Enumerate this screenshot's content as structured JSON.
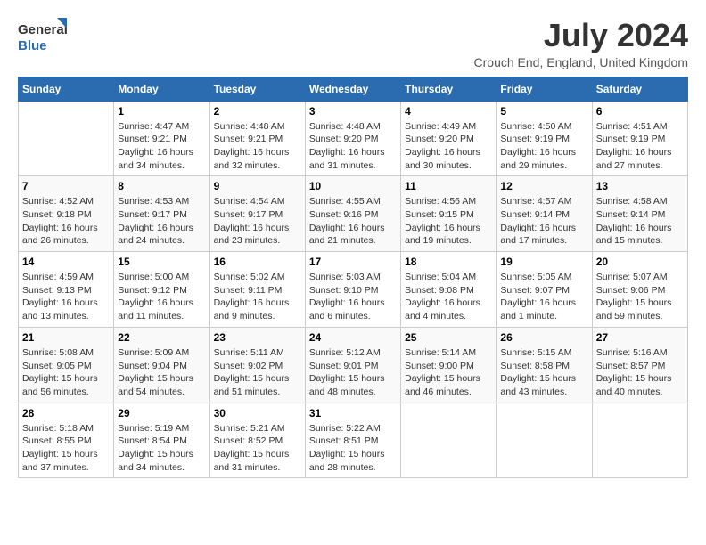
{
  "logo": {
    "text_general": "General",
    "text_blue": "Blue"
  },
  "header": {
    "month_title": "July 2024",
    "location": "Crouch End, England, United Kingdom"
  },
  "days_of_week": [
    "Sunday",
    "Monday",
    "Tuesday",
    "Wednesday",
    "Thursday",
    "Friday",
    "Saturday"
  ],
  "weeks": [
    [
      {
        "day": "",
        "sunrise": "",
        "sunset": "",
        "daylight": ""
      },
      {
        "day": "1",
        "sunrise": "Sunrise: 4:47 AM",
        "sunset": "Sunset: 9:21 PM",
        "daylight": "Daylight: 16 hours and 34 minutes."
      },
      {
        "day": "2",
        "sunrise": "Sunrise: 4:48 AM",
        "sunset": "Sunset: 9:21 PM",
        "daylight": "Daylight: 16 hours and 32 minutes."
      },
      {
        "day": "3",
        "sunrise": "Sunrise: 4:48 AM",
        "sunset": "Sunset: 9:20 PM",
        "daylight": "Daylight: 16 hours and 31 minutes."
      },
      {
        "day": "4",
        "sunrise": "Sunrise: 4:49 AM",
        "sunset": "Sunset: 9:20 PM",
        "daylight": "Daylight: 16 hours and 30 minutes."
      },
      {
        "day": "5",
        "sunrise": "Sunrise: 4:50 AM",
        "sunset": "Sunset: 9:19 PM",
        "daylight": "Daylight: 16 hours and 29 minutes."
      },
      {
        "day": "6",
        "sunrise": "Sunrise: 4:51 AM",
        "sunset": "Sunset: 9:19 PM",
        "daylight": "Daylight: 16 hours and 27 minutes."
      }
    ],
    [
      {
        "day": "7",
        "sunrise": "Sunrise: 4:52 AM",
        "sunset": "Sunset: 9:18 PM",
        "daylight": "Daylight: 16 hours and 26 minutes."
      },
      {
        "day": "8",
        "sunrise": "Sunrise: 4:53 AM",
        "sunset": "Sunset: 9:17 PM",
        "daylight": "Daylight: 16 hours and 24 minutes."
      },
      {
        "day": "9",
        "sunrise": "Sunrise: 4:54 AM",
        "sunset": "Sunset: 9:17 PM",
        "daylight": "Daylight: 16 hours and 23 minutes."
      },
      {
        "day": "10",
        "sunrise": "Sunrise: 4:55 AM",
        "sunset": "Sunset: 9:16 PM",
        "daylight": "Daylight: 16 hours and 21 minutes."
      },
      {
        "day": "11",
        "sunrise": "Sunrise: 4:56 AM",
        "sunset": "Sunset: 9:15 PM",
        "daylight": "Daylight: 16 hours and 19 minutes."
      },
      {
        "day": "12",
        "sunrise": "Sunrise: 4:57 AM",
        "sunset": "Sunset: 9:14 PM",
        "daylight": "Daylight: 16 hours and 17 minutes."
      },
      {
        "day": "13",
        "sunrise": "Sunrise: 4:58 AM",
        "sunset": "Sunset: 9:14 PM",
        "daylight": "Daylight: 16 hours and 15 minutes."
      }
    ],
    [
      {
        "day": "14",
        "sunrise": "Sunrise: 4:59 AM",
        "sunset": "Sunset: 9:13 PM",
        "daylight": "Daylight: 16 hours and 13 minutes."
      },
      {
        "day": "15",
        "sunrise": "Sunrise: 5:00 AM",
        "sunset": "Sunset: 9:12 PM",
        "daylight": "Daylight: 16 hours and 11 minutes."
      },
      {
        "day": "16",
        "sunrise": "Sunrise: 5:02 AM",
        "sunset": "Sunset: 9:11 PM",
        "daylight": "Daylight: 16 hours and 9 minutes."
      },
      {
        "day": "17",
        "sunrise": "Sunrise: 5:03 AM",
        "sunset": "Sunset: 9:10 PM",
        "daylight": "Daylight: 16 hours and 6 minutes."
      },
      {
        "day": "18",
        "sunrise": "Sunrise: 5:04 AM",
        "sunset": "Sunset: 9:08 PM",
        "daylight": "Daylight: 16 hours and 4 minutes."
      },
      {
        "day": "19",
        "sunrise": "Sunrise: 5:05 AM",
        "sunset": "Sunset: 9:07 PM",
        "daylight": "Daylight: 16 hours and 1 minute."
      },
      {
        "day": "20",
        "sunrise": "Sunrise: 5:07 AM",
        "sunset": "Sunset: 9:06 PM",
        "daylight": "Daylight: 15 hours and 59 minutes."
      }
    ],
    [
      {
        "day": "21",
        "sunrise": "Sunrise: 5:08 AM",
        "sunset": "Sunset: 9:05 PM",
        "daylight": "Daylight: 15 hours and 56 minutes."
      },
      {
        "day": "22",
        "sunrise": "Sunrise: 5:09 AM",
        "sunset": "Sunset: 9:04 PM",
        "daylight": "Daylight: 15 hours and 54 minutes."
      },
      {
        "day": "23",
        "sunrise": "Sunrise: 5:11 AM",
        "sunset": "Sunset: 9:02 PM",
        "daylight": "Daylight: 15 hours and 51 minutes."
      },
      {
        "day": "24",
        "sunrise": "Sunrise: 5:12 AM",
        "sunset": "Sunset: 9:01 PM",
        "daylight": "Daylight: 15 hours and 48 minutes."
      },
      {
        "day": "25",
        "sunrise": "Sunrise: 5:14 AM",
        "sunset": "Sunset: 9:00 PM",
        "daylight": "Daylight: 15 hours and 46 minutes."
      },
      {
        "day": "26",
        "sunrise": "Sunrise: 5:15 AM",
        "sunset": "Sunset: 8:58 PM",
        "daylight": "Daylight: 15 hours and 43 minutes."
      },
      {
        "day": "27",
        "sunrise": "Sunrise: 5:16 AM",
        "sunset": "Sunset: 8:57 PM",
        "daylight": "Daylight: 15 hours and 40 minutes."
      }
    ],
    [
      {
        "day": "28",
        "sunrise": "Sunrise: 5:18 AM",
        "sunset": "Sunset: 8:55 PM",
        "daylight": "Daylight: 15 hours and 37 minutes."
      },
      {
        "day": "29",
        "sunrise": "Sunrise: 5:19 AM",
        "sunset": "Sunset: 8:54 PM",
        "daylight": "Daylight: 15 hours and 34 minutes."
      },
      {
        "day": "30",
        "sunrise": "Sunrise: 5:21 AM",
        "sunset": "Sunset: 8:52 PM",
        "daylight": "Daylight: 15 hours and 31 minutes."
      },
      {
        "day": "31",
        "sunrise": "Sunrise: 5:22 AM",
        "sunset": "Sunset: 8:51 PM",
        "daylight": "Daylight: 15 hours and 28 minutes."
      },
      {
        "day": "",
        "sunrise": "",
        "sunset": "",
        "daylight": ""
      },
      {
        "day": "",
        "sunrise": "",
        "sunset": "",
        "daylight": ""
      },
      {
        "day": "",
        "sunrise": "",
        "sunset": "",
        "daylight": ""
      }
    ]
  ]
}
